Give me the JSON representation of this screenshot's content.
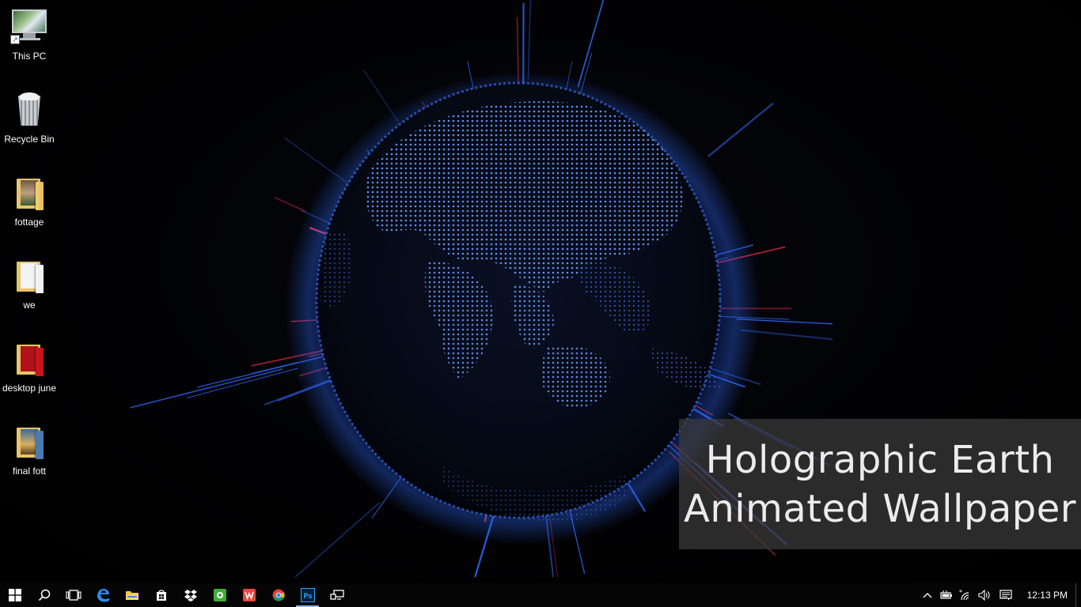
{
  "desktop": {
    "icons": [
      {
        "label": "This PC",
        "icon": "this-pc-icon"
      },
      {
        "label": "Recycle Bin",
        "icon": "recycle-bin-icon"
      },
      {
        "label": "fottage",
        "icon": "folder-icon"
      },
      {
        "label": "we",
        "icon": "folder-icon"
      },
      {
        "label": "desktop june",
        "icon": "folder-icon"
      },
      {
        "label": "final fott",
        "icon": "folder-icon"
      }
    ]
  },
  "wallpaper": {
    "caption_line1": "Holographic Earth",
    "caption_line2": "Animated Wallpaper"
  },
  "taskbar": {
    "pinned": [
      {
        "name": "start",
        "icon": "windows-logo-icon"
      },
      {
        "name": "search",
        "icon": "search-icon"
      },
      {
        "name": "task-view",
        "icon": "task-view-icon"
      },
      {
        "name": "edge",
        "icon": "edge-icon"
      },
      {
        "name": "file-explorer",
        "icon": "folder-icon"
      },
      {
        "name": "store",
        "icon": "store-icon"
      },
      {
        "name": "dropbox",
        "icon": "dropbox-icon"
      },
      {
        "name": "app-green",
        "icon": "green-app-icon"
      },
      {
        "name": "wps",
        "icon": "wps-icon"
      },
      {
        "name": "chrome",
        "icon": "chrome-icon"
      },
      {
        "name": "photoshop",
        "icon": "photoshop-icon",
        "label": "Ps",
        "active": true
      },
      {
        "name": "connect",
        "icon": "connect-icon"
      }
    ],
    "tray": {
      "clock": "12:13 PM"
    }
  },
  "colors": {
    "globe_blue": "#2f6bff",
    "streak_red": "#ff3050",
    "taskbar_bg": "#050506",
    "active_indicator": "#8fb6e8"
  }
}
